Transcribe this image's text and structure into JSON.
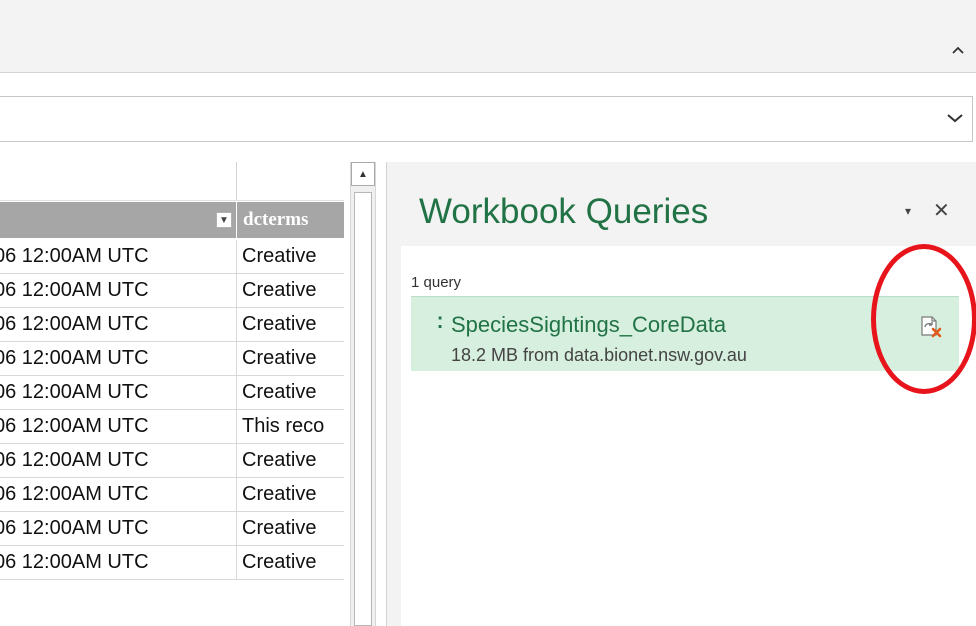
{
  "ribbon": {
    "collapse_icon": "chevron-up-icon"
  },
  "formula_bar": {
    "expand_icon": "chevron-down-icon"
  },
  "grid": {
    "column_b_header": "dcterms",
    "rows": [
      {
        "a": "06 12:00AM UTC",
        "b": "Creative"
      },
      {
        "a": "06 12:00AM UTC",
        "b": "Creative"
      },
      {
        "a": "06 12:00AM UTC",
        "b": "Creative"
      },
      {
        "a": "06 12:00AM UTC",
        "b": "Creative"
      },
      {
        "a": "06 12:00AM UTC",
        "b": "Creative"
      },
      {
        "a": "06 12:00AM UTC",
        "b": "This reco"
      },
      {
        "a": "06 12:00AM UTC",
        "b": "Creative"
      },
      {
        "a": "06 12:00AM UTC",
        "b": "Creative"
      },
      {
        "a": "06 12:00AM UTC",
        "b": "Creative"
      },
      {
        "a": "06 12:00AM UTC",
        "b": "Creative"
      }
    ]
  },
  "pane": {
    "title": "Workbook Queries",
    "dropdown_glyph": "▾",
    "close_glyph": "✕",
    "query_count": "1 query",
    "query": {
      "name": "SpeciesSightings_CoreData",
      "meta": "18.2 MB from data.bionet.nsw.gov.au",
      "status_icon": "query-error-icon"
    }
  },
  "colors": {
    "accent_green": "#217346",
    "query_highlight": "#d6efde",
    "annotation_red": "#e8141c",
    "column_header_gray": "#a6a6a6"
  }
}
